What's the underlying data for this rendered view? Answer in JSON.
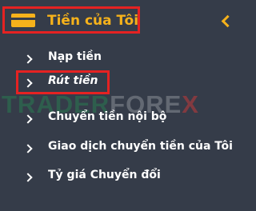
{
  "header": {
    "title": "Tiền của Tôi"
  },
  "items": [
    {
      "label": "Nạp tiền"
    },
    {
      "label": "Rút tiền"
    },
    {
      "label": "Chuyển tiền nội bộ"
    },
    {
      "label": "Giao dịch chuyển tiền của Tôi"
    },
    {
      "label": "Tỷ giá Chuyển đổi"
    }
  ],
  "watermark": {
    "part1": "TRADER",
    "part2": "FORE",
    "part3": "X"
  },
  "colors": {
    "background": "#353c49",
    "accent": "#f6b21b",
    "highlight": "#e52222",
    "text": "#ffffff"
  },
  "icons": {
    "header": "wallet-icon",
    "collapse": "chevron-left-icon",
    "item": "chevron-right-icon"
  }
}
